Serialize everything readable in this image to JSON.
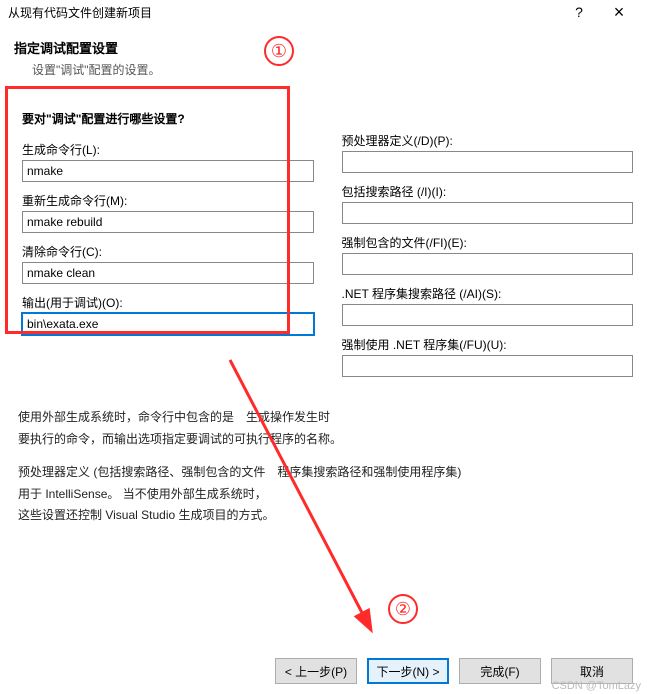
{
  "titlebar": {
    "title": "从现有代码文件创建新项目",
    "help": "?",
    "close": "×"
  },
  "header": {
    "heading": "指定调试配置设置",
    "sub": "设置\"调试\"配置的设置。"
  },
  "question": "要对\"调试\"配置进行哪些设置?",
  "left": {
    "build_label": "生成命令行(L):",
    "build_value": "nmake",
    "rebuild_label": "重新生成命令行(M):",
    "rebuild_value": "nmake rebuild",
    "clean_label": "清除命令行(C):",
    "clean_value": "nmake clean",
    "output_label": "输出(用于调试)(O):",
    "output_value": "bin\\exata.exe"
  },
  "right": {
    "preproc_label": "预处理器定义(/D)(P):",
    "preproc_value": "",
    "include_label": "包括搜索路径 (/I)(I):",
    "include_value": "",
    "forced_label": "强制包含的文件(/FI)(E):",
    "forced_value": "",
    "assembly_label": ".NET 程序集搜索路径 (/AI)(S):",
    "assembly_value": "",
    "forcedusing_label": "强制使用 .NET 程序集(/FU)(U):",
    "forcedusing_value": ""
  },
  "desc": {
    "p1a": "使用外部生成系统时，命令行中包含的是",
    "p1b": "生成操作发生时",
    "p2": "要执行的命令，而输出选项指定要调试的可执行程序的名称。",
    "p3a": "预处理器定义 (包括搜索路径、强制包含的文件",
    "p3b": "程序集搜索路径和强制使用程序集)",
    "p4": "用于 IntelliSense。  当不使用外部生成系统时，",
    "p5": "这些设置还控制 Visual Studio 生成项目的方式。"
  },
  "annotations": {
    "one": "①",
    "two": "②"
  },
  "footer": {
    "prev": "< 上一步(P)",
    "next": "下一步(N) >",
    "finish": "完成(F)",
    "cancel": "取消"
  },
  "watermark": "CSDN @TomLazy"
}
